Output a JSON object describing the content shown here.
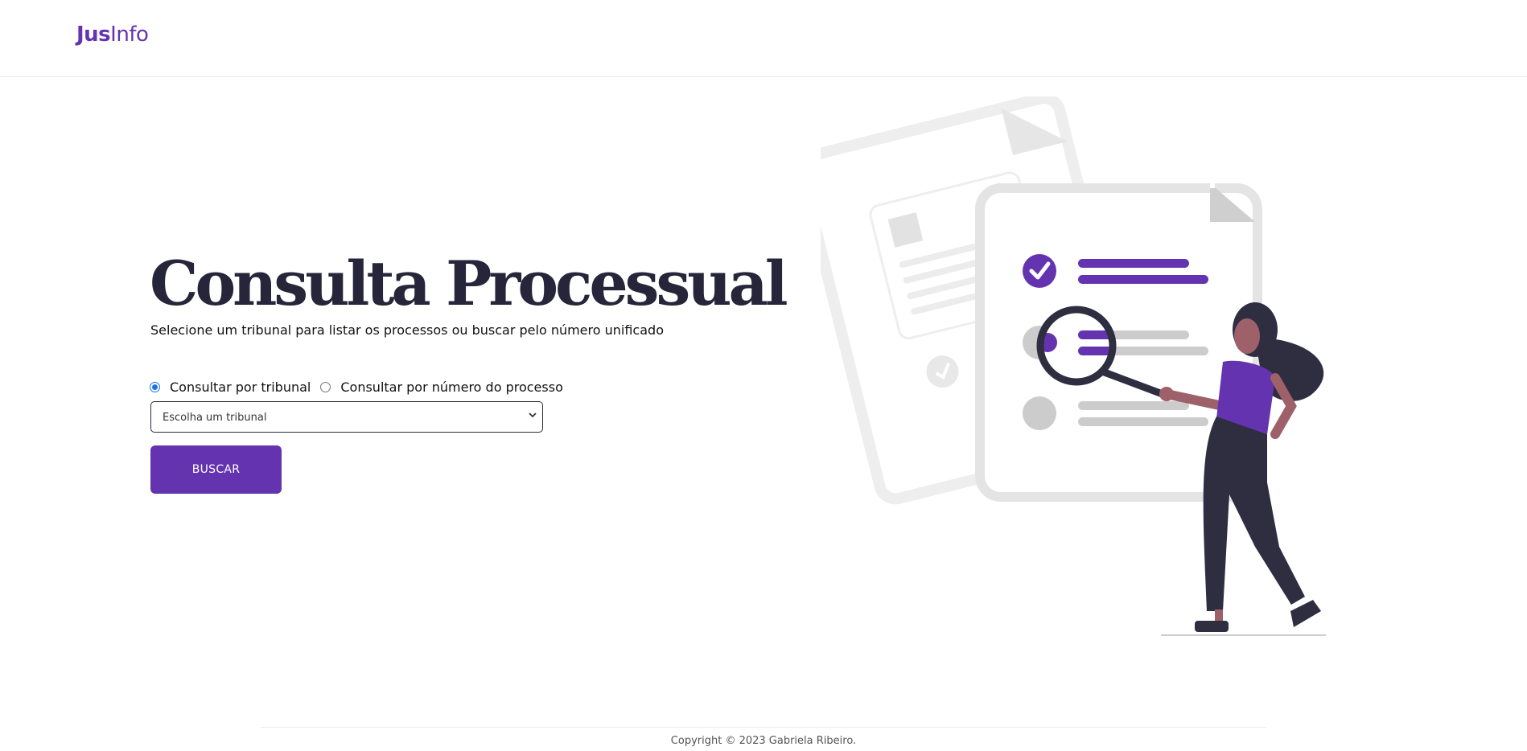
{
  "header": {
    "logo_bold": "Jus",
    "logo_regular": "Info"
  },
  "hero": {
    "title": "Consulta Processual",
    "subtitle": "Selecione um tribunal para listar os processos ou buscar pelo número unificado"
  },
  "search_mode": {
    "option_tribunal": "Consultar por tribunal",
    "option_numero": "Consultar por número do processo",
    "selected": "tribunal"
  },
  "tribunal_select": {
    "selected_value": "Escolha um tribunal"
  },
  "buttons": {
    "search_label": "BUSCAR"
  },
  "footer": {
    "copyright": "Copyright © 2023 Gabriela Ribeiro."
  },
  "colors": {
    "brand": "#6434b0",
    "title": "#26253a",
    "accent_radio": "#1a73e8"
  }
}
